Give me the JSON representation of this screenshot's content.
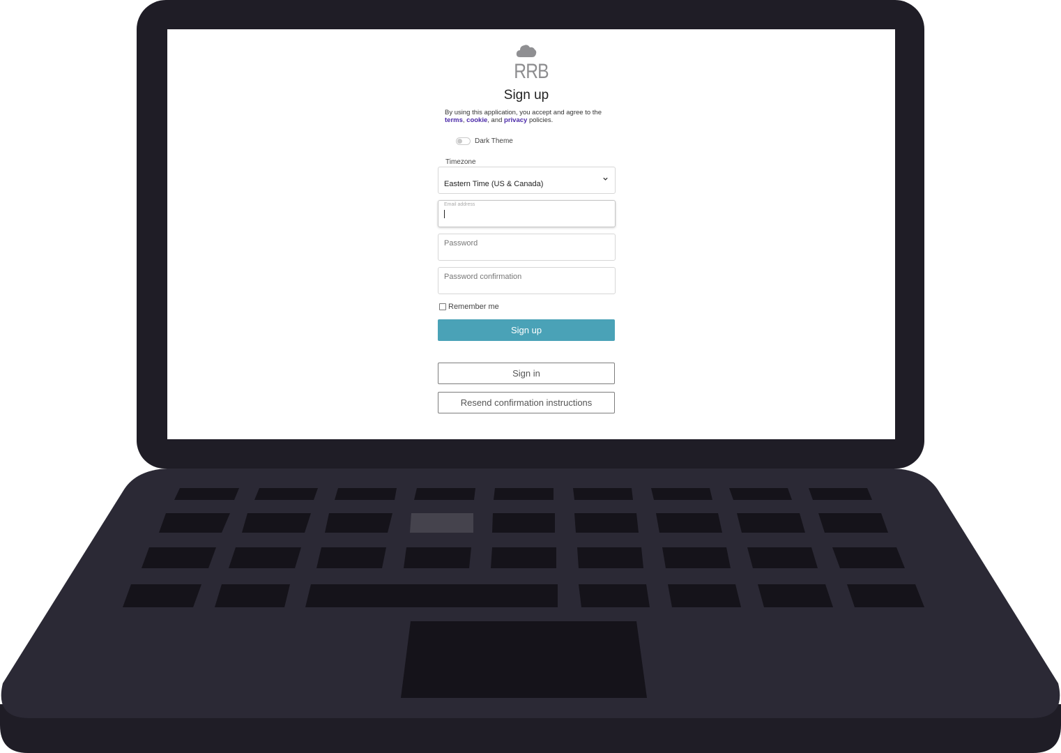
{
  "brand": {
    "name": "RRB",
    "logo_icon": "cloud-icon"
  },
  "signup": {
    "title": "Sign up",
    "legal": {
      "prefix": "By using this application, you accept and agree to the",
      "terms": "terms",
      "comma1": ",",
      "cookie": "cookie",
      "and": ", and",
      "privacy": "privacy",
      "suffix": "policies."
    },
    "dark_theme": {
      "label": "Dark Theme",
      "enabled": false
    },
    "timezone": {
      "label": "Timezone",
      "value": "Eastern Time (US & Canada)",
      "icon": "chevron-down-icon"
    },
    "email": {
      "placeholder": "Email address",
      "value": ""
    },
    "password": {
      "placeholder": "Password",
      "value": ""
    },
    "password_confirmation": {
      "placeholder": "Password confirmation",
      "value": ""
    },
    "remember_me": {
      "label": "Remember me",
      "checked": false
    },
    "submit_label": "Sign up",
    "sign_in_label": "Sign in",
    "resend_label": "Resend confirmation instructions"
  },
  "colors": {
    "primary_button": "#4aa2b7",
    "link": "#4b2aa8",
    "laptop_body": "#1f1d26",
    "laptop_deck": "#2b2935"
  }
}
